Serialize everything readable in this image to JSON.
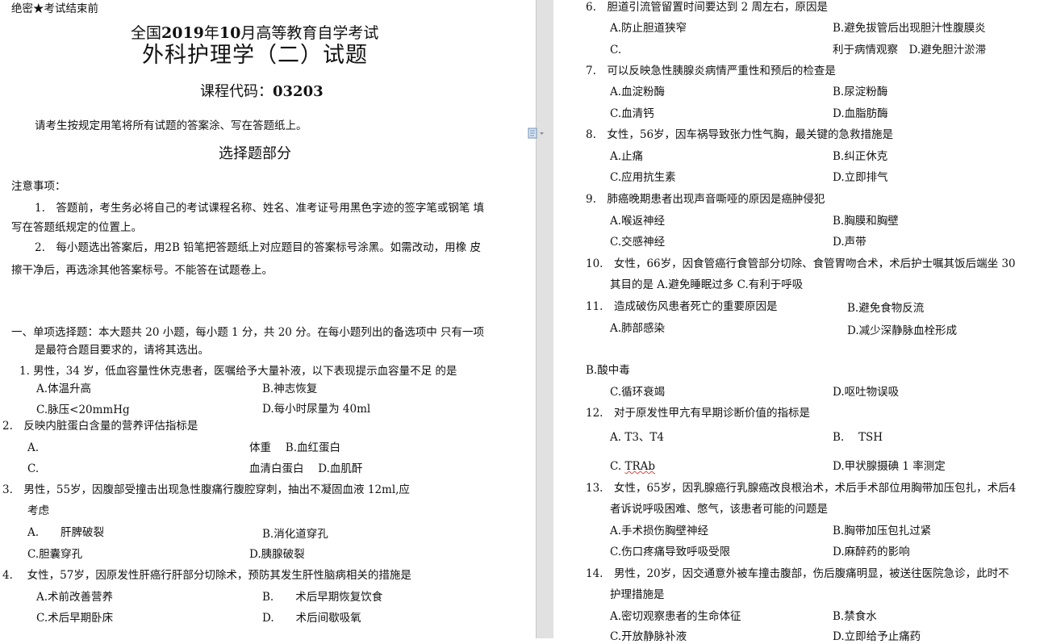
{
  "left_page": {
    "secret": "绝密★考试结束前",
    "exam_title": {
      "pre": "全国",
      "year": "2019",
      "mid": "年",
      "month": "10",
      "post": "月高等教育自学考试"
    },
    "subject": "外科护理学（二）试题",
    "course_code": {
      "label": "课程代码：",
      "value": "03203"
    },
    "instruction": "请考生按规定用笔将所有试题的答案涂、写在答题纸上。",
    "part_title": "选择题部分",
    "notes_title": "注意事项：",
    "note1_line1": "1.　答题前，考生务必将自己的考试课程名称、姓名、准考证号用黑色字迹的签字笔或钢笔 填",
    "note1_line2": "写在答题纸规定的位置上。",
    "note2_line1": "2.　每小题选出答案后，用2B 铅笔把答题纸上对应题目的答案标号涂黑。如需改动，用橡 皮",
    "note2_line2": "擦干净后，再选涂其他答案标号。不能答在试题卷上。",
    "section1_line1": "一、单项选择题：本大题共 20 小题，每小题 1 分，共 20 分。在每小题列出的备选项中 只有一项",
    "section1_line2": "是最符合题目要求的，请将其选出。",
    "q1": "1. 男性，34 岁，低血容量性休克患者，医嘱给予大量补液，以下表现提示血容量不足 的是",
    "q1_a": "A.体温升高",
    "q1_b": "B.神志恢复",
    "q1_c": "C.脉压<20mmHg",
    "q1_d": "D.每小时尿量为 40ml",
    "q2": "2.　反映内脏蛋白含量的营养评估指标是",
    "q2_a_letter": "A.",
    "q2_a_tail": "体重　 B.血红蛋白",
    "q2_c_letter": "C.",
    "q2_c_tail": "血清白蛋白　 D.血肌酐",
    "q3_line1": "3.　男性，55岁，因腹部受撞击出现急性腹痛行腹腔穿刺，抽出不凝固血液 12ml,应",
    "q3_line2": "考虑",
    "q3_a": "A.　　肝脾破裂",
    "q3_b": "B.消化道穿孔",
    "q3_c": "C.胆囊穿孔",
    "q3_d": "D.胰腺破裂",
    "q4": "4.　 女性，57岁，因原发性肝癌行肝部分切除术，预防其发生肝性脑病相关的措施是",
    "q4_a": "A.术前改善营养",
    "q4_b": "B.　　术后早期恢复饮食",
    "q4_c": "C.术后早期卧床",
    "q4_d": "D.　　术后间歇吸氧"
  },
  "right_page": {
    "q6": "6.　胆道引流管留置时间要达到 2 周左右，原因是",
    "q6_a": "A.防止胆道狭窄",
    "q6_b": "B.避免拔管后出现胆汁性腹膜炎",
    "q6_c": "C.",
    "q6_cd": "利于病情观察　D.避免胆汁淤滞",
    "q7": "7.　可以反映急性胰腺炎病情严重性和预后的检查是",
    "q7_a": "A.血淀粉酶",
    "q7_b": "B.尿淀粉酶",
    "q7_c": "C.血清钙",
    "q7_d": "D.血脂肪酶",
    "q8": "8.　女性，56岁，因车祸导致张力性气胸，最关键的急救措施是",
    "q8_a": "A.止痛",
    "q8_b": "B.纠正休克",
    "q8_c": "C.应用抗生素",
    "q8_d": "D.立即排气",
    "q9": "9.　肺癌晚期患者出现声音嘶哑的原因是癌肿侵犯",
    "q9_a": "A.喉返神经",
    "q9_b": "B.胸膜和胸壁",
    "q9_c": "C.交感神经",
    "q9_d": "D.声带",
    "q10_line1": "10.　女性，66岁，因食管癌行食管部分切除、食管胃吻合术，术后护士嘱其饭后端坐 30",
    "q10_line2": "其目的是  A.避免睡眠过多  C.有利于呼吸",
    "q11": "11.　造成破伤风患者死亡的重要原因是",
    "q11_b": "B.避免食物反流",
    "q11_a": "A.肺部感染",
    "q11_d": "D.减少深静脉血栓形成",
    "q11_bb": "B.酸中毒",
    "q11_c": "C.循环衰竭",
    "q11_dd": "D.呕吐物误吸",
    "q12": "12.　对于原发性甲亢有早期诊断价值的指标是",
    "q12_a": "A. T3、T4",
    "q12_b": "B.　 TSH",
    "q12_c_pre": "C. ",
    "q12_c": "TRAb",
    "q12_d": "D.甲状腺摄碘 1 率测定",
    "q13_line1": "13.　女性，65岁，因乳腺癌行乳腺癌改良根治术，术后手术部位用胸带加压包扎，术后4",
    "q13_line2": "者诉说呼吸困难、憋气，该患者可能的问题是",
    "q13_a": "A.手术损伤胸壁神经",
    "q13_b": "B.胸带加压包扎过紧",
    "q13_c": "C.伤口疼痛导致呼吸受限",
    "q13_d": "D.麻醉药的影响",
    "q14_line1": "14.　男性，20岁，因交通意外被车撞击腹部，伤后腹痛明显，被送往医院急诊，此时不",
    "q14_line2": "护理措施是",
    "q14_a": "A.密切观察患者的生命体征",
    "q14_b": "B.禁食水",
    "q14_c": "C.开放静脉补液",
    "q14_d": "D.立即给予止痛药"
  },
  "colors": {
    "gutter": "#e1e1e1",
    "icon": "#6f8fb5",
    "text": "#111111"
  }
}
